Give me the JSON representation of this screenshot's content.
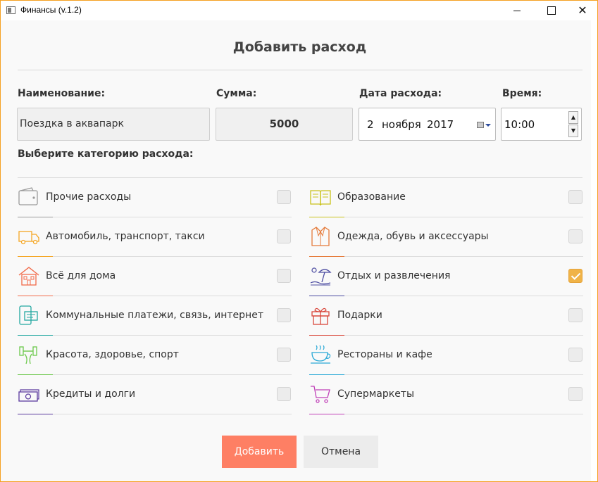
{
  "window": {
    "title": "Финансы (v.1.2)"
  },
  "heading": "Добавить расход",
  "form": {
    "name_label": "Наименование:",
    "name_value": "Поездка в аквапарк",
    "sum_label": "Сумма:",
    "sum_value": "5000",
    "date_label": "Дата расхода:",
    "date_day": "2",
    "date_month": "ноября",
    "date_year": "2017",
    "time_label": "Время:",
    "time_value": "10:00"
  },
  "categories_label": "Выберите категорию расхода:",
  "categories_left": [
    {
      "label": "Прочие расходы",
      "icon": "wallet-icon",
      "color": "#9a9a9a",
      "checked": false
    },
    {
      "label": "Автомобиль, транспорт, такси",
      "icon": "truck-icon",
      "color": "#f5a623",
      "checked": false
    },
    {
      "label": "Всё для дома",
      "icon": "house-icon",
      "color": "#f26b4a",
      "checked": false
    },
    {
      "label": "Коммунальные платежи, связь, интернет",
      "icon": "phone-bill-icon",
      "color": "#22a7a0",
      "checked": false
    },
    {
      "label": "Красота, здоровье, спорт",
      "icon": "dumbbell-icon",
      "color": "#6bc84a",
      "checked": false
    },
    {
      "label": "Кредиты и долги",
      "icon": "money-icon",
      "color": "#5b3a9e",
      "checked": false
    }
  ],
  "categories_right": [
    {
      "label": "Образование",
      "icon": "book-icon",
      "color": "#c9c21a",
      "checked": false
    },
    {
      "label": "Одежда, обувь и аксессуары",
      "icon": "jacket-icon",
      "color": "#e57a3a",
      "checked": false
    },
    {
      "label": "Отдых и развлечения",
      "icon": "beach-icon",
      "color": "#4a4aa0",
      "checked": true
    },
    {
      "label": "Подарки",
      "icon": "gift-icon",
      "color": "#d9463a",
      "checked": false
    },
    {
      "label": "Рестораны и кафе",
      "icon": "coffee-cup-icon",
      "color": "#2aa9d6",
      "checked": false
    },
    {
      "label": "Супермаркеты",
      "icon": "cart-icon",
      "color": "#c040b8",
      "checked": false
    }
  ],
  "buttons": {
    "add": "Добавить",
    "cancel": "Отмена"
  },
  "colors": {
    "accent": "#fe7f64",
    "checkbox_on": "#f0b347",
    "window_border": "#f5a020"
  }
}
